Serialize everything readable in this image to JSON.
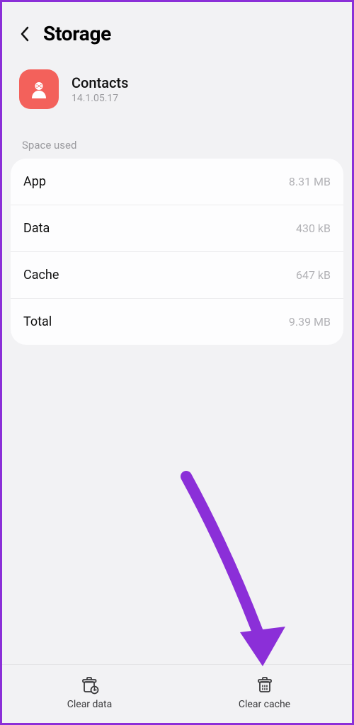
{
  "header": {
    "title": "Storage"
  },
  "app": {
    "name": "Contacts",
    "version": "14.1.05.17"
  },
  "section": {
    "label": "Space used"
  },
  "rows": [
    {
      "label": "App",
      "value": "8.31 MB"
    },
    {
      "label": "Data",
      "value": "430 kB"
    },
    {
      "label": "Cache",
      "value": "647 kB"
    },
    {
      "label": "Total",
      "value": "9.39 MB"
    }
  ],
  "actions": {
    "clear_data": "Clear data",
    "clear_cache": "Clear cache"
  }
}
